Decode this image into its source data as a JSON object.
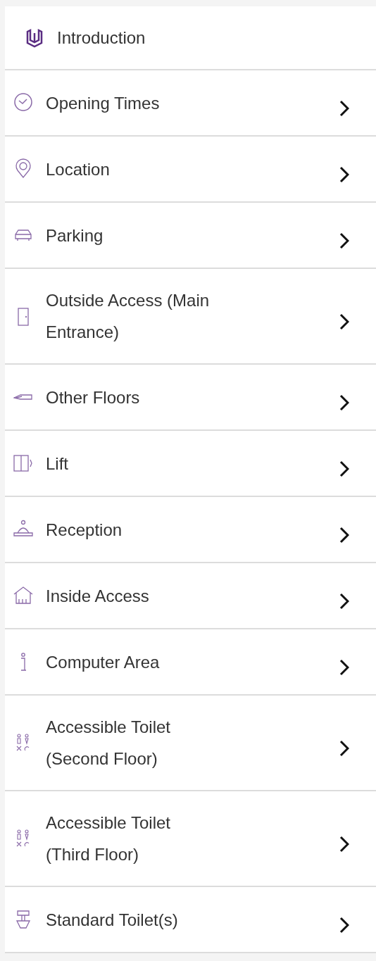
{
  "menu": [
    {
      "label": "Introduction",
      "chevron": false,
      "kind": "header"
    },
    {
      "label": "Opening Times",
      "chevron": true,
      "kind": "item"
    },
    {
      "label": "Location",
      "chevron": true,
      "kind": "item"
    },
    {
      "label": "Parking",
      "chevron": true,
      "kind": "item"
    },
    {
      "label": "Outside Access (Main Entrance)",
      "chevron": true,
      "kind": "item"
    },
    {
      "label": "Other Floors",
      "chevron": true,
      "kind": "item"
    },
    {
      "label": "Lift",
      "chevron": true,
      "kind": "item"
    },
    {
      "label": "Reception",
      "chevron": true,
      "kind": "item"
    },
    {
      "label": "Inside Access",
      "chevron": true,
      "kind": "item"
    },
    {
      "label": "Computer Area",
      "chevron": true,
      "kind": "item"
    },
    {
      "label": "Accessible Toilet (Second Floor)",
      "chevron": true,
      "kind": "item"
    },
    {
      "label": "Accessible Toilet (Third Floor)",
      "chevron": true,
      "kind": "item"
    },
    {
      "label": "Standard Toilet(s)",
      "chevron": true,
      "kind": "item"
    }
  ]
}
